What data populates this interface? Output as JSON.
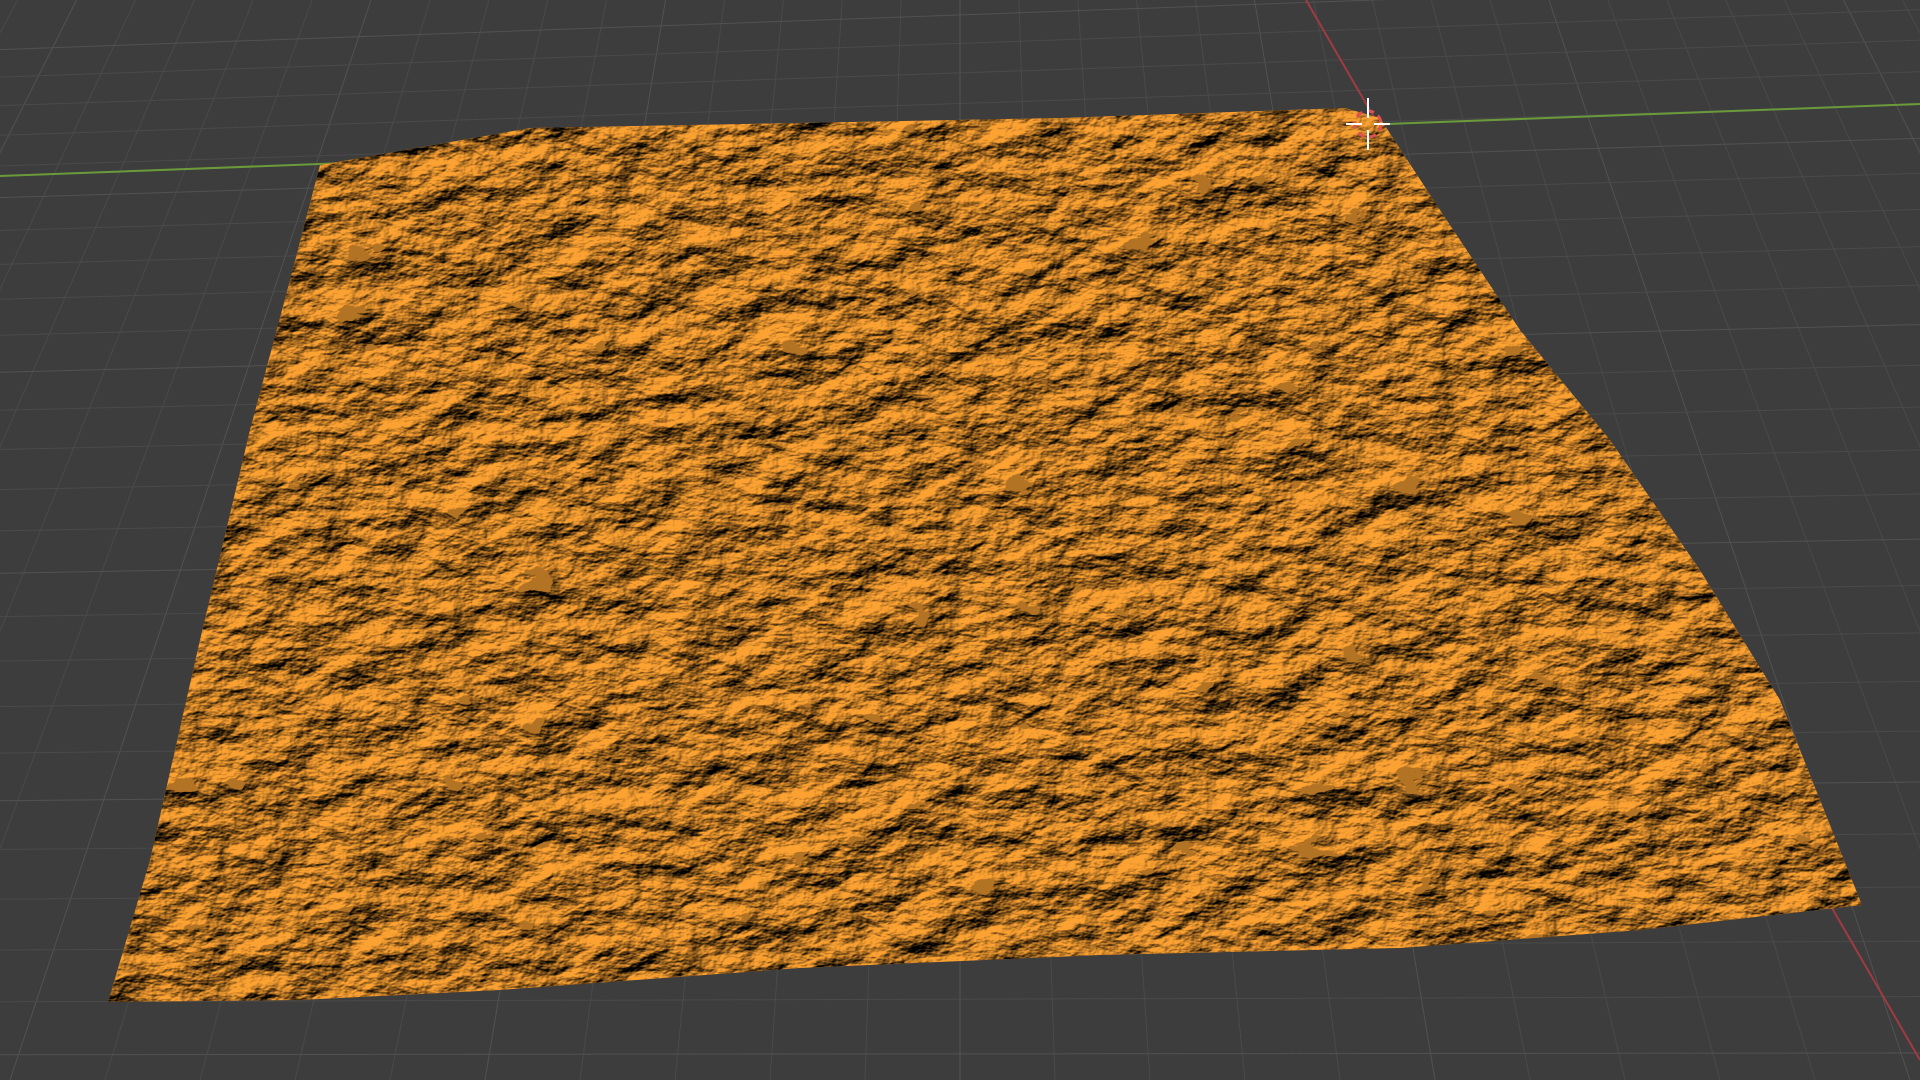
{
  "viewport": {
    "view": "3D Viewport",
    "background_color": "#3d3d3d",
    "grid_color": "#4a4a4a",
    "grid_major_color": "#525252",
    "axis_x_color": "#a13a42",
    "axis_y_color": "#6b9a3a",
    "selected_object": {
      "name": "terrain-mesh",
      "type": "mesh",
      "state": "selected",
      "highlight_color": "#f09a30",
      "shade_color": "#c9761c"
    },
    "gizmos": [
      {
        "name": "3d-cursor",
        "icon": "crosshair-target-icon",
        "colors": [
          "#ffffff",
          "#e05050"
        ]
      }
    ]
  }
}
